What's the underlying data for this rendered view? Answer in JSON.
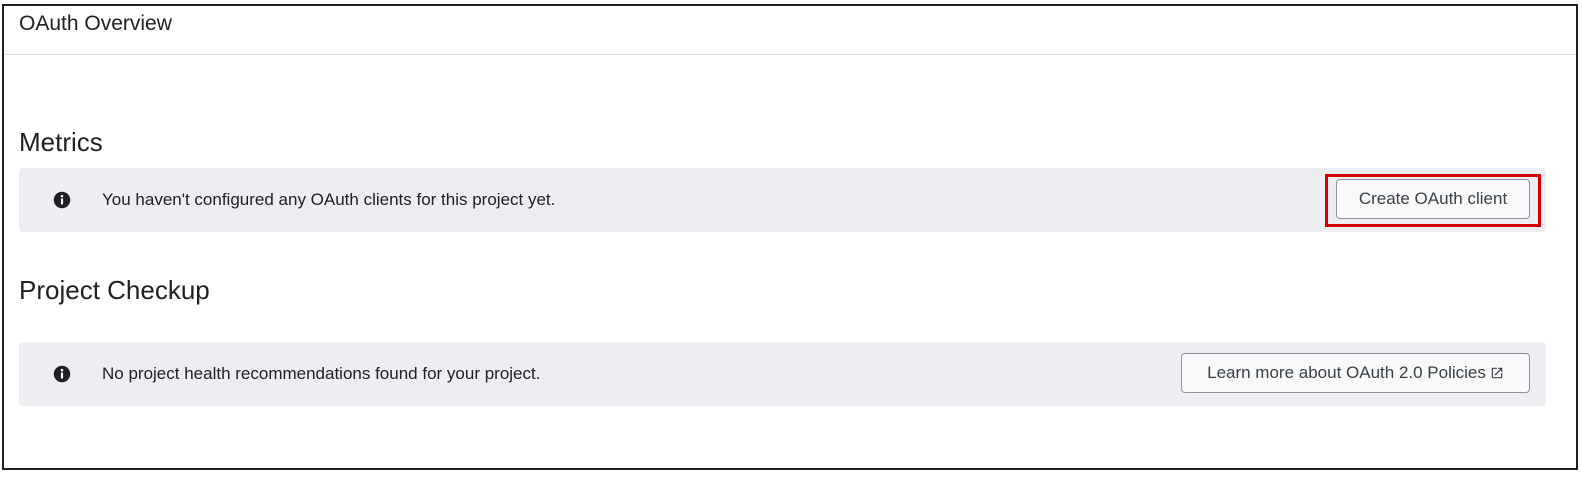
{
  "header": {
    "title": "OAuth Overview"
  },
  "sections": {
    "metrics": {
      "title": "Metrics",
      "banner_icon": "info-icon",
      "banner_text": "You haven't configured any OAuth clients for this project yet.",
      "button_label": "Create OAuth client"
    },
    "checkup": {
      "title": "Project Checkup",
      "banner_icon": "info-icon",
      "banner_text": "No project health recommendations found for your project.",
      "button_label": "Learn more about OAuth 2.0 Policies",
      "button_icon": "external-link-icon"
    }
  },
  "colors": {
    "banner_background": "#eceef1",
    "highlight_border": "#d20000",
    "text": "#202124"
  }
}
